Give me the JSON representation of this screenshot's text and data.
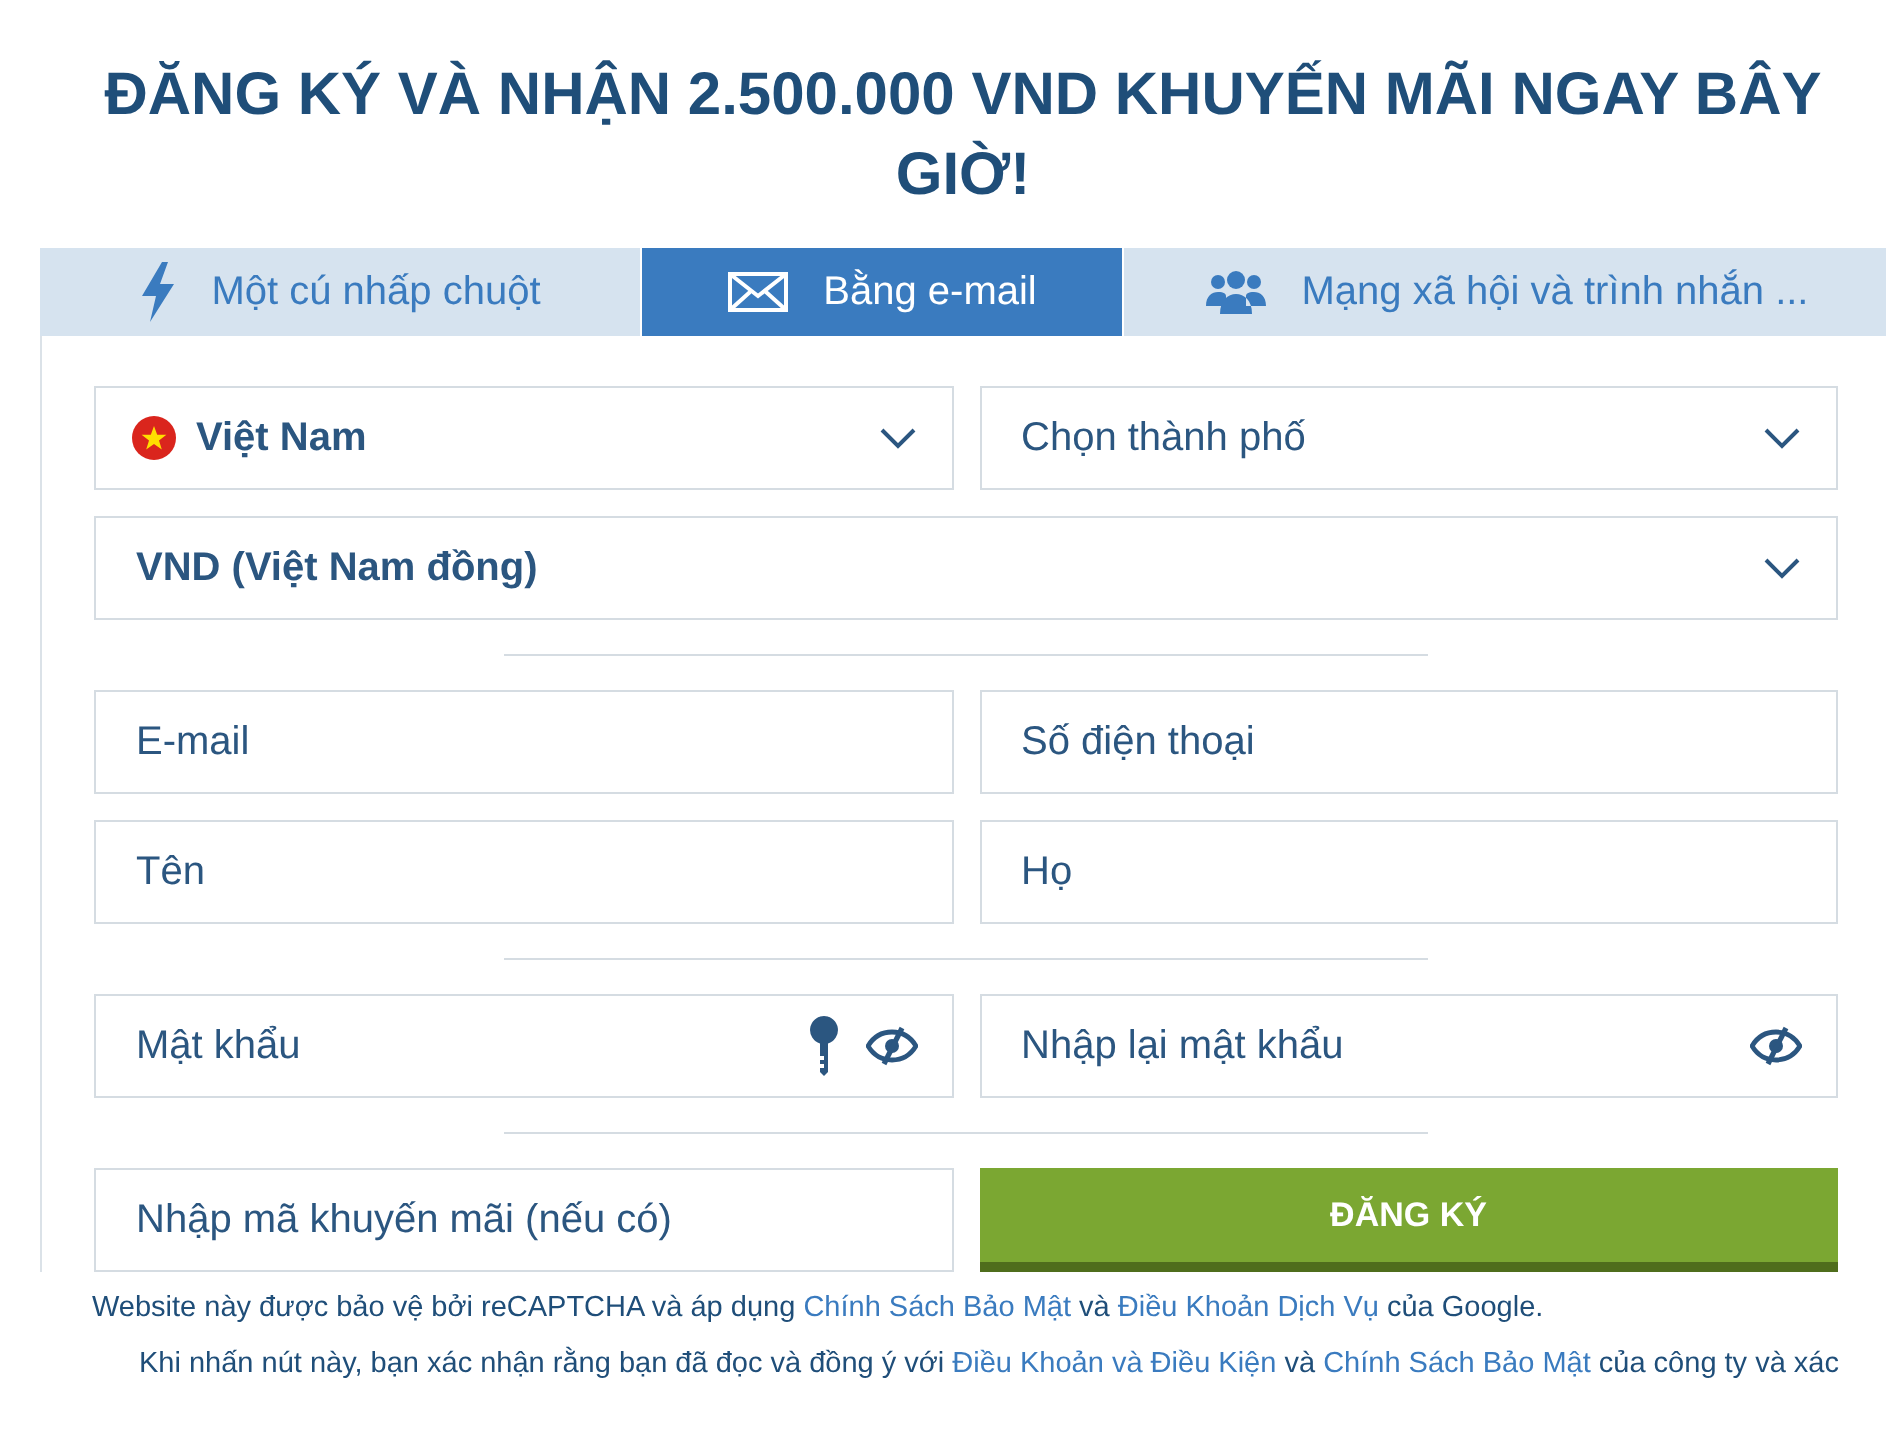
{
  "title": "ĐĂNG KÝ VÀ NHẬN 2.500.000 VND KHUYẾN MÃI NGAY BÂY GIỜ!",
  "tabs": [
    {
      "label": "Một cú nhấp chuột",
      "selected": false
    },
    {
      "label": "Bằng e-mail",
      "selected": true
    },
    {
      "label": "Mạng xã hội và trình nhắn ...",
      "selected": false
    }
  ],
  "rows": [
    {
      "kind": "selects",
      "items": [
        {
          "value": "Việt Nam",
          "flag": true
        },
        {
          "placeholder": "Chọn thành phố"
        }
      ]
    },
    {
      "kind": "selects",
      "items": [
        {
          "value": "VND (Việt Nam đồng)"
        }
      ]
    },
    {
      "kind": "divider"
    },
    {
      "kind": "inputs",
      "items": [
        {
          "placeholder": "E-mail"
        },
        {
          "placeholder": "Số điện thoại"
        }
      ]
    },
    {
      "kind": "inputs",
      "items": [
        {
          "placeholder": "Tên"
        },
        {
          "placeholder": "Họ"
        }
      ]
    },
    {
      "kind": "divider"
    },
    {
      "kind": "passwords",
      "items": [
        {
          "placeholder": "Mật khẩu",
          "generate": true
        },
        {
          "placeholder": "Nhập lại mật khẩu",
          "generate": false
        }
      ]
    },
    {
      "kind": "divider"
    },
    {
      "kind": "submit",
      "promo": {
        "placeholder": "Nhập mã khuyến mãi (nếu có)"
      },
      "button": "ĐĂNG KÝ"
    }
  ],
  "notes": [
    [
      {
        "kind": "text",
        "text": "Website này được bảo vệ bởi reCAPTCHA và áp dụng "
      },
      {
        "kind": "link",
        "text": "Chính Sách Bảo Mật"
      },
      {
        "kind": "text",
        "text": " và "
      },
      {
        "kind": "link",
        "text": "Điều Khoản Dịch Vụ"
      },
      {
        "kind": "text",
        "text": " của Google."
      }
    ],
    [
      {
        "kind": "text",
        "text": "Khi nhấn nút này, bạn xác nhận rằng bạn đã đọc và đồng ý với "
      },
      {
        "kind": "link",
        "text": "Điều Khoản và Điều Kiện"
      },
      {
        "kind": "text",
        "text": " và "
      },
      {
        "kind": "link",
        "text": "Chính Sách Bảo Mật"
      },
      {
        "kind": "text",
        "text": " của công ty và xác"
      }
    ]
  ]
}
